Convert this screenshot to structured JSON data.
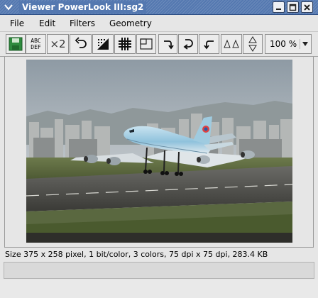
{
  "window": {
    "title": "Viewer PowerLook III:sg2",
    "buttons": [
      "minimize",
      "maximize",
      "close"
    ]
  },
  "menubar": {
    "items": [
      {
        "id": "file",
        "label": "File"
      },
      {
        "id": "edit",
        "label": "Edit"
      },
      {
        "id": "filters",
        "label": "Filters"
      },
      {
        "id": "geometry",
        "label": "Geometry"
      }
    ]
  },
  "toolbar": {
    "items": [
      {
        "id": "save",
        "icon": "save-icon"
      },
      {
        "id": "text",
        "icon": "abc-def-icon",
        "label_top": "ABC",
        "label_bottom": "DEF"
      },
      {
        "id": "zoom-x2",
        "icon": "zoom-x2-icon",
        "label": "×2"
      },
      {
        "id": "undo",
        "icon": "undo-icon"
      },
      {
        "id": "halftone",
        "icon": "halftone-icon"
      },
      {
        "id": "grid",
        "icon": "grid-icon"
      },
      {
        "id": "crop",
        "icon": "crop-icon"
      },
      {
        "id": "rotate-cw",
        "icon": "rotate-cw-icon"
      },
      {
        "id": "rotate-180",
        "icon": "rotate-180-icon"
      },
      {
        "id": "rotate-ccw",
        "icon": "rotate-ccw-icon"
      },
      {
        "id": "mirror",
        "icon": "mirror-icon"
      },
      {
        "id": "flip",
        "icon": "flip-icon"
      }
    ],
    "zoom": {
      "value": "100 %"
    }
  },
  "image": {
    "subject": "Boeing 747 taking off over runway"
  },
  "status": {
    "text": "Size 375 x 258 pixel, 1 bit/color, 3 colors, 75 dpi x 75 dpi, 283.4 KB"
  },
  "colors": {
    "titlebar": "#5478b0",
    "background": "#e6e6e6",
    "save_icon": "#2e8b3e"
  }
}
